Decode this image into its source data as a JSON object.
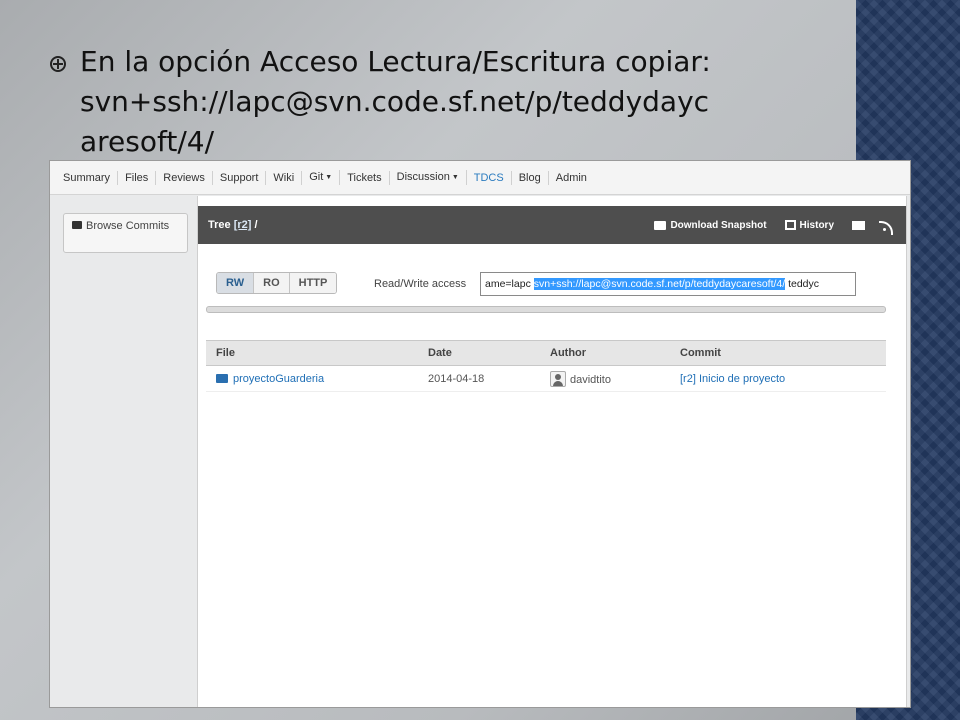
{
  "slide": {
    "bullet_text": "En la opción Acceso Lectura/Escritura copiar:\nsvn+ssh://lapc@svn.code.sf.net/p/teddydayc\naresoft/4/"
  },
  "nav": {
    "items": [
      {
        "label": "Summary"
      },
      {
        "label": "Files"
      },
      {
        "label": "Reviews"
      },
      {
        "label": "Support"
      },
      {
        "label": "Wiki"
      },
      {
        "label": "Git"
      },
      {
        "label": "Tickets"
      },
      {
        "label": "Discussion"
      },
      {
        "label": "TDCS"
      },
      {
        "label": "Blog"
      },
      {
        "label": "Admin"
      }
    ],
    "active": "TDCS"
  },
  "sidebar": {
    "browse_commits_label": "Browse Commits"
  },
  "tree": {
    "title_prefix": "Tree",
    "revision_link": "[r2]",
    "title_suffix": "/",
    "download_snapshot": "Download Snapshot",
    "history": "History"
  },
  "access": {
    "tabs": [
      {
        "label": "RW"
      },
      {
        "label": "RO"
      },
      {
        "label": "HTTP"
      }
    ],
    "active_tab": "RW",
    "label": "Read/Write access",
    "input_prefix": "ame=lapc ",
    "input_selected": "svn+ssh://lapc@svn.code.sf.net/p/teddydaycaresoft/4/",
    "input_suffix": " teddyc"
  },
  "table": {
    "headers": {
      "file": "File",
      "date": "Date",
      "author": "Author",
      "commit": "Commit"
    },
    "rows": [
      {
        "file": "proyectoGuarderia",
        "date": "2014-04-18",
        "author": "davidtito",
        "commit": "[r2] Inicio de proyecto"
      }
    ]
  },
  "colors": {
    "accent_blue": "#1f6fb6",
    "selection": "#3399ff",
    "side_band": "#243a62",
    "titlebar": "#4e4e4e"
  },
  "icons": [
    "bullet-icon",
    "folder-icon",
    "history-icon",
    "mail-icon",
    "rss-icon",
    "avatar-icon",
    "caret-down-icon"
  ]
}
